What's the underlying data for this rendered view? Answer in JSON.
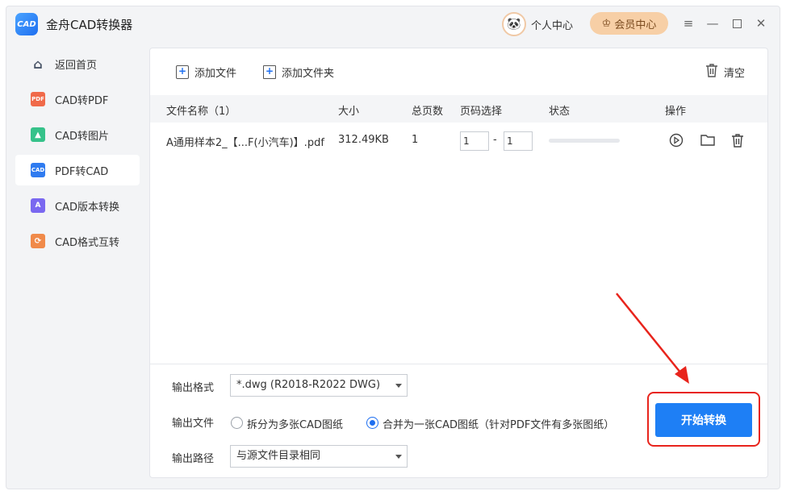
{
  "app": {
    "logo_text": "CAD",
    "title": "金舟CAD转换器",
    "user_center_label": "个人中心",
    "vip_label": "会员中心",
    "window_controls": [
      "menu-icon",
      "minimize-icon",
      "maximize-icon",
      "close-icon"
    ]
  },
  "sidebar": {
    "items": [
      {
        "label": "返回首页",
        "icon": "home-icon",
        "color": "#4a5568"
      },
      {
        "label": "CAD转PDF",
        "icon": "pdf-icon",
        "color": "#f06a4a"
      },
      {
        "label": "CAD转图片",
        "icon": "image-icon",
        "color": "#36c28a"
      },
      {
        "label": "PDF转CAD",
        "icon": "cad-icon",
        "color": "#2f7bf0",
        "active": true
      },
      {
        "label": "CAD版本转换",
        "icon": "version-icon",
        "color": "#7a68f0"
      },
      {
        "label": "CAD格式互转",
        "icon": "format-icon",
        "color": "#f08a4a"
      }
    ]
  },
  "toolbar": {
    "add_file": "添加文件",
    "add_folder": "添加文件夹",
    "clear": "清空"
  },
  "table": {
    "headers": {
      "name": "文件名称（1）",
      "size": "大小",
      "pages": "总页数",
      "page_select": "页码选择",
      "status": "状态",
      "actions": "操作"
    },
    "rows": [
      {
        "name": "A通用样本2_【...F(小汽车)】.pdf",
        "size": "312.49KB",
        "pages": "1",
        "page_from": "1",
        "page_sep": "-",
        "page_to": "1",
        "progress": 0
      }
    ]
  },
  "output": {
    "format_label": "输出格式",
    "format_value": "*.dwg (R2018-R2022 DWG)",
    "file_label": "输出文件",
    "option_split": "拆分为多张CAD图纸",
    "option_merge": "合并为一张CAD图纸（针对PDF文件有多张图纸）",
    "selected_option": "merge",
    "path_label": "输出路径",
    "path_value": "与源文件目录相同"
  },
  "start_button": "开始转换",
  "colors": {
    "accent": "#1e7ff5",
    "highlight": "#e8241c"
  }
}
